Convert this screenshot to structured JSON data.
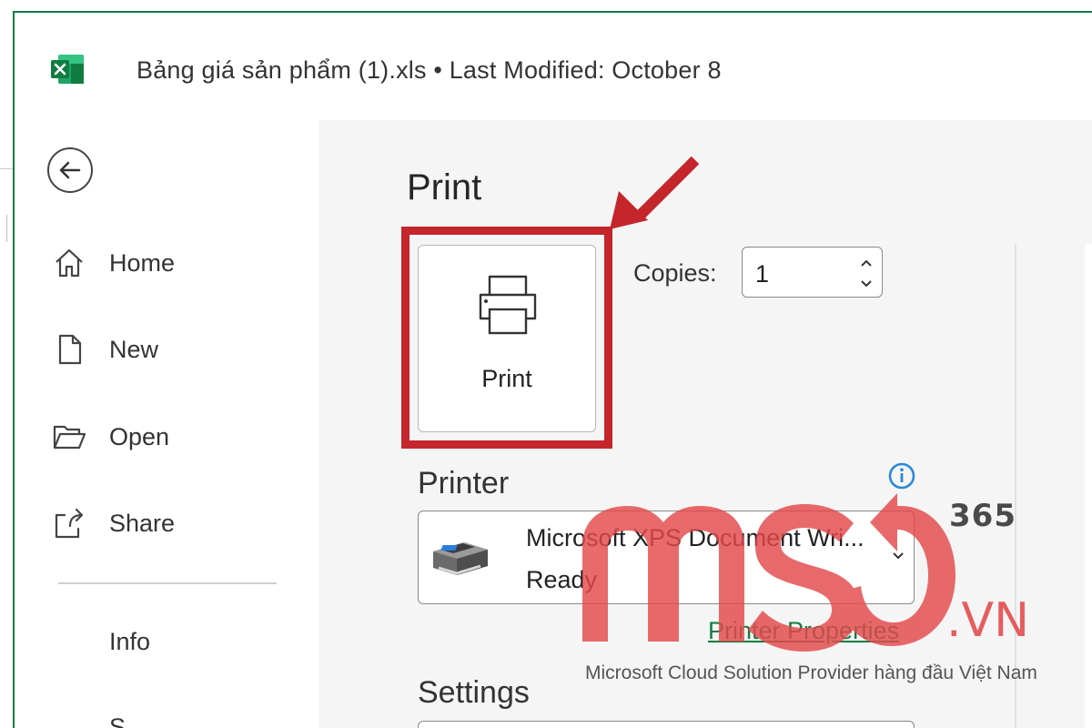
{
  "titlebar": {
    "app_icon": "excel-icon",
    "title": "Bảng giá sản phẩm (1).xls  •  Last Modified: October 8"
  },
  "nav": {
    "back_icon": "back-arrow-icon",
    "items": [
      {
        "label": "Home",
        "icon": "home-icon"
      },
      {
        "label": "New",
        "icon": "new-file-icon"
      },
      {
        "label": "Open",
        "icon": "folder-open-icon"
      },
      {
        "label": "Share",
        "icon": "share-icon"
      }
    ],
    "info": "Info",
    "save_partial": "S"
  },
  "print_panel": {
    "title": "Print",
    "print_button_label": "Print",
    "copies_label": "Copies:",
    "copies_value": "1",
    "printer_heading": "Printer",
    "printer_name": "Microsoft XPS Document Wri...",
    "printer_status": "Ready",
    "printer_properties": "Printer Properties",
    "settings_heading": "Settings"
  },
  "watermark": {
    "badge": "365",
    "domain": ".VN",
    "tagline": "Microsoft Cloud Solution Provider hàng đầu Việt Nam"
  },
  "colors": {
    "excel_green": "#107c41",
    "highlight_red": "#c4262b",
    "watermark_red": "#e4494b"
  }
}
